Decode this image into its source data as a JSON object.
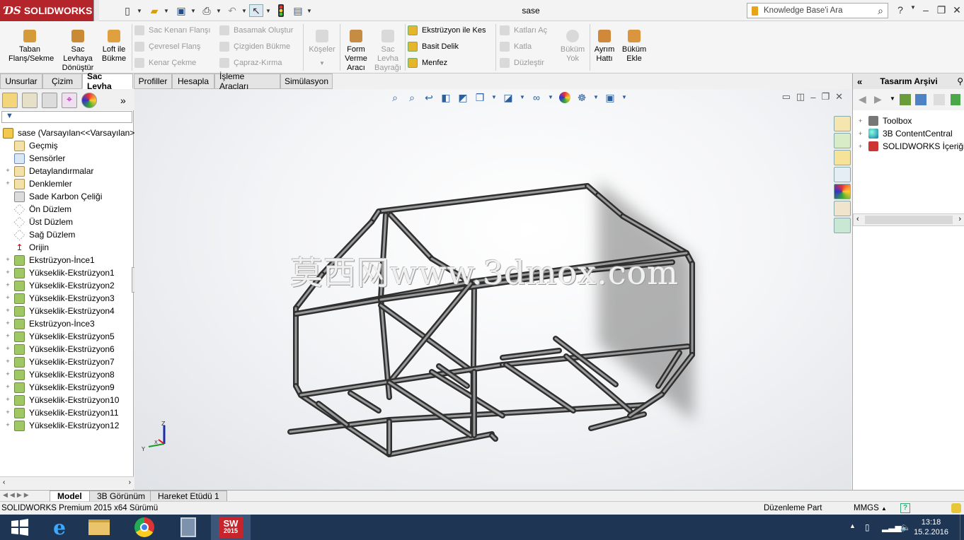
{
  "app": {
    "brand": "SOLIDWORKS",
    "document_title": "sase"
  },
  "search": {
    "placeholder": "Knowledge Base'i Ara"
  },
  "ribbon": {
    "big_buttons": [
      {
        "label": "Taban Flanş/Sekme",
        "enabled": true,
        "icon": "base-flange-icon"
      },
      {
        "label": "Sac Levhaya Dönüştür",
        "enabled": true,
        "icon": "convert-sheet-metal-icon"
      },
      {
        "label": "Loft ile Bükme",
        "enabled": true,
        "icon": "lofted-bend-icon"
      },
      {
        "label": "Köşeler",
        "enabled": false,
        "icon": "corners-icon"
      },
      {
        "label": "Form Verme Aracı",
        "enabled": true,
        "icon": "forming-tool-icon"
      },
      {
        "label": "Sac Levha Bayrağı",
        "enabled": false,
        "icon": "sheet-metal-gusset-icon"
      },
      {
        "label": "Büküm Yok",
        "enabled": false,
        "icon": "no-bends-icon"
      },
      {
        "label": "Ayrım Hattı",
        "enabled": true,
        "icon": "rip-icon"
      },
      {
        "label": "Büküm Ekle",
        "enabled": true,
        "icon": "insert-bends-icon"
      }
    ],
    "col1": [
      {
        "label": "Sac Kenarı Flanşı",
        "enabled": false
      },
      {
        "label": "Çevresel Flanş",
        "enabled": false
      },
      {
        "label": "Kenar Çekme",
        "enabled": false
      }
    ],
    "col2": [
      {
        "label": "Basamak Oluştur",
        "enabled": false
      },
      {
        "label": "Çizgiden Bükme",
        "enabled": false
      },
      {
        "label": "Çapraz-Kırma",
        "enabled": false
      }
    ],
    "col3": [
      {
        "label": "Ekstrüzyon ile Kes",
        "enabled": true
      },
      {
        "label": "Basit Delik",
        "enabled": true
      },
      {
        "label": "Menfez",
        "enabled": true
      }
    ],
    "col4": [
      {
        "label": "Katları Aç",
        "enabled": false
      },
      {
        "label": "Katla",
        "enabled": false
      },
      {
        "label": "Düzleştir",
        "enabled": false
      }
    ]
  },
  "command_tabs": [
    "Unsurlar",
    "Çizim",
    "Sac Levha",
    "Profiller",
    "Hesapla",
    "İşleme Araçları",
    "Simülasyon"
  ],
  "active_command_tab": "Sac Levha",
  "feature_tree": {
    "root": "sase  (Varsayılan<<Varsayılan>_",
    "items": [
      {
        "label": "Geçmiş",
        "icon": "history-icon",
        "expand": ""
      },
      {
        "label": "Sensörler",
        "icon": "sensor-icon",
        "expand": ""
      },
      {
        "label": "Detaylandırmalar",
        "icon": "annotation-icon",
        "expand": "+"
      },
      {
        "label": "Denklemler",
        "icon": "equation-icon",
        "expand": "+"
      },
      {
        "label": "Sade Karbon Çeliği",
        "icon": "material-icon",
        "expand": ""
      },
      {
        "label": "Ön Düzlem",
        "icon": "plane-icon",
        "expand": ""
      },
      {
        "label": "Üst Düzlem",
        "icon": "plane-icon",
        "expand": ""
      },
      {
        "label": "Sağ Düzlem",
        "icon": "plane-icon",
        "expand": ""
      },
      {
        "label": "Orijin",
        "icon": "origin-icon",
        "expand": ""
      },
      {
        "label": "Ekstrüzyon-İnce1",
        "icon": "extrude-icon",
        "expand": "+"
      },
      {
        "label": "Yükseklik-Ekstrüzyon1",
        "icon": "extrude-icon",
        "expand": "+"
      },
      {
        "label": "Yükseklik-Ekstrüzyon2",
        "icon": "extrude-icon",
        "expand": "+"
      },
      {
        "label": "Yükseklik-Ekstrüzyon3",
        "icon": "extrude-icon",
        "expand": "+"
      },
      {
        "label": "Yükseklik-Ekstrüzyon4",
        "icon": "extrude-icon",
        "expand": "+"
      },
      {
        "label": "Ekstrüzyon-İnce3",
        "icon": "extrude-icon",
        "expand": "+"
      },
      {
        "label": "Yükseklik-Ekstrüzyon5",
        "icon": "extrude-icon",
        "expand": "+"
      },
      {
        "label": "Yükseklik-Ekstrüzyon6",
        "icon": "extrude-icon",
        "expand": "+"
      },
      {
        "label": "Yükseklik-Ekstrüzyon7",
        "icon": "extrude-icon",
        "expand": "+"
      },
      {
        "label": "Yükseklik-Ekstrüzyon8",
        "icon": "extrude-icon",
        "expand": "+"
      },
      {
        "label": "Yükseklik-Ekstrüzyon9",
        "icon": "extrude-icon",
        "expand": "+"
      },
      {
        "label": "Yükseklik-Ekstrüzyon10",
        "icon": "extrude-icon",
        "expand": "+"
      },
      {
        "label": "Yükseklik-Ekstrüzyon11",
        "icon": "extrude-icon",
        "expand": "+"
      },
      {
        "label": "Yükseklik-Ekstrüzyon12",
        "icon": "extrude-icon",
        "expand": "+"
      }
    ]
  },
  "viewport": {
    "watermark": "莫西网www.3dmox.com",
    "triad": {
      "x": "X",
      "y": "Y",
      "z": "Z"
    }
  },
  "task_pane": {
    "title": "Tasarım Arşivi",
    "items": [
      {
        "label": "Toolbox",
        "icon": "toolbox-icon"
      },
      {
        "label": "3B ContentCentral",
        "icon": "globe-icon"
      },
      {
        "label": "SOLIDWORKS İçeriği",
        "icon": "solidworks-content-icon"
      }
    ]
  },
  "bottom_tabs": [
    "Model",
    "3B Görünüm",
    "Hareket Etüdü 1"
  ],
  "active_bottom_tab": "Model",
  "status": {
    "version": "SOLIDWORKS Premium 2015 x64 Sürümü",
    "mode": "Düzenleme Part",
    "units": "MMGS"
  },
  "taskbar": {
    "time": "13:18",
    "date": "15.2.2016",
    "sw_badge": "2015"
  },
  "colors": {
    "brand_red": "#b4252b",
    "taskbar": "#1e3554",
    "frame_tube": "#4a4a4a"
  }
}
